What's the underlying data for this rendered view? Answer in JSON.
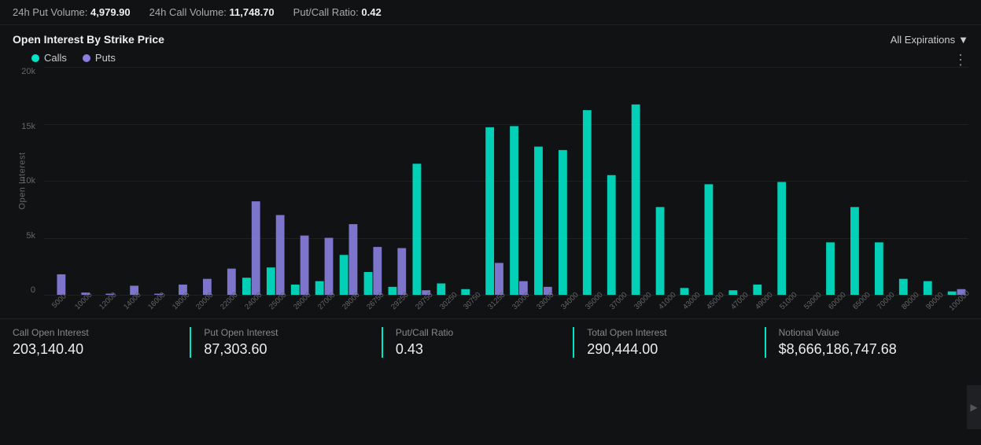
{
  "topbar": {
    "put_volume_label": "24h Put Volume:",
    "put_volume_value": "4,979.90",
    "call_volume_label": "24h Call Volume:",
    "call_volume_value": "11,748.70",
    "ratio_label": "Put/Call Ratio:",
    "ratio_value": "0.42"
  },
  "chart": {
    "title": "Open Interest By Strike Price",
    "expiry_label": "All Expirations",
    "legend": {
      "calls_label": "Calls",
      "puts_label": "Puts"
    },
    "y_labels": [
      "20k",
      "15k",
      "10k",
      "5k",
      "0"
    ],
    "y_axis_label": "Open Interest",
    "x_labels": [
      "5000",
      "10000",
      "12000",
      "14000",
      "16000",
      "18000",
      "20000",
      "22000",
      "24000",
      "25000",
      "26000",
      "27000",
      "28000",
      "26750",
      "29250",
      "29750",
      "30250",
      "30750",
      "31250",
      "32000",
      "33000",
      "34000",
      "35000",
      "37000",
      "39000",
      "41000",
      "43000",
      "45000",
      "47000",
      "49000",
      "51000",
      "53000",
      "60000",
      "65000",
      "70000",
      "80000",
      "90000",
      "100000"
    ],
    "bars": [
      {
        "strike": "5000",
        "calls": 0,
        "puts": 1800
      },
      {
        "strike": "10000",
        "calls": 0,
        "puts": 200
      },
      {
        "strike": "12000",
        "calls": 0,
        "puts": 100
      },
      {
        "strike": "14000",
        "calls": 0,
        "puts": 800
      },
      {
        "strike": "16000",
        "calls": 0,
        "puts": 100
      },
      {
        "strike": "18000",
        "calls": 0,
        "puts": 900
      },
      {
        "strike": "20000",
        "calls": 0,
        "puts": 1400
      },
      {
        "strike": "22000",
        "calls": 0,
        "puts": 2300
      },
      {
        "strike": "24000",
        "calls": 1500,
        "puts": 8200
      },
      {
        "strike": "25000",
        "calls": 2400,
        "puts": 7000
      },
      {
        "strike": "26000",
        "calls": 900,
        "puts": 5200
      },
      {
        "strike": "27000",
        "calls": 1200,
        "puts": 5000
      },
      {
        "strike": "28000",
        "calls": 3500,
        "puts": 6200
      },
      {
        "strike": "26750",
        "calls": 2000,
        "puts": 4200
      },
      {
        "strike": "29250",
        "calls": 700,
        "puts": 4100
      },
      {
        "strike": "29750",
        "calls": 11500,
        "puts": 400
      },
      {
        "strike": "30250",
        "calls": 1000,
        "puts": 0
      },
      {
        "strike": "30750",
        "calls": 500,
        "puts": 0
      },
      {
        "strike": "31250",
        "calls": 14700,
        "puts": 2800
      },
      {
        "strike": "32000",
        "calls": 14800,
        "puts": 1200
      },
      {
        "strike": "33000",
        "calls": 13000,
        "puts": 700
      },
      {
        "strike": "34000",
        "calls": 12700,
        "puts": 0
      },
      {
        "strike": "35000",
        "calls": 16200,
        "puts": 0
      },
      {
        "strike": "37000",
        "calls": 10500,
        "puts": 0
      },
      {
        "strike": "39000",
        "calls": 16700,
        "puts": 0
      },
      {
        "strike": "41000",
        "calls": 7700,
        "puts": 0
      },
      {
        "strike": "43000",
        "calls": 600,
        "puts": 0
      },
      {
        "strike": "45000",
        "calls": 9700,
        "puts": 0
      },
      {
        "strike": "47000",
        "calls": 400,
        "puts": 0
      },
      {
        "strike": "49000",
        "calls": 900,
        "puts": 0
      },
      {
        "strike": "51000",
        "calls": 9900,
        "puts": 0
      },
      {
        "strike": "53000",
        "calls": 0,
        "puts": 0
      },
      {
        "strike": "60000",
        "calls": 4600,
        "puts": 0
      },
      {
        "strike": "65000",
        "calls": 7700,
        "puts": 0
      },
      {
        "strike": "70000",
        "calls": 4600,
        "puts": 0
      },
      {
        "strike": "80000",
        "calls": 1400,
        "puts": 0
      },
      {
        "strike": "90000",
        "calls": 1200,
        "puts": 0
      },
      {
        "strike": "100000",
        "calls": 300,
        "puts": 500
      }
    ]
  },
  "stats": [
    {
      "label": "Call Open Interest",
      "value": "203,140.40"
    },
    {
      "label": "Put Open Interest",
      "value": "87,303.60"
    },
    {
      "label": "Put/Call Ratio",
      "value": "0.43"
    },
    {
      "label": "Total Open Interest",
      "value": "290,444.00"
    },
    {
      "label": "Notional Value",
      "value": "$8,666,186,747.68"
    }
  ]
}
